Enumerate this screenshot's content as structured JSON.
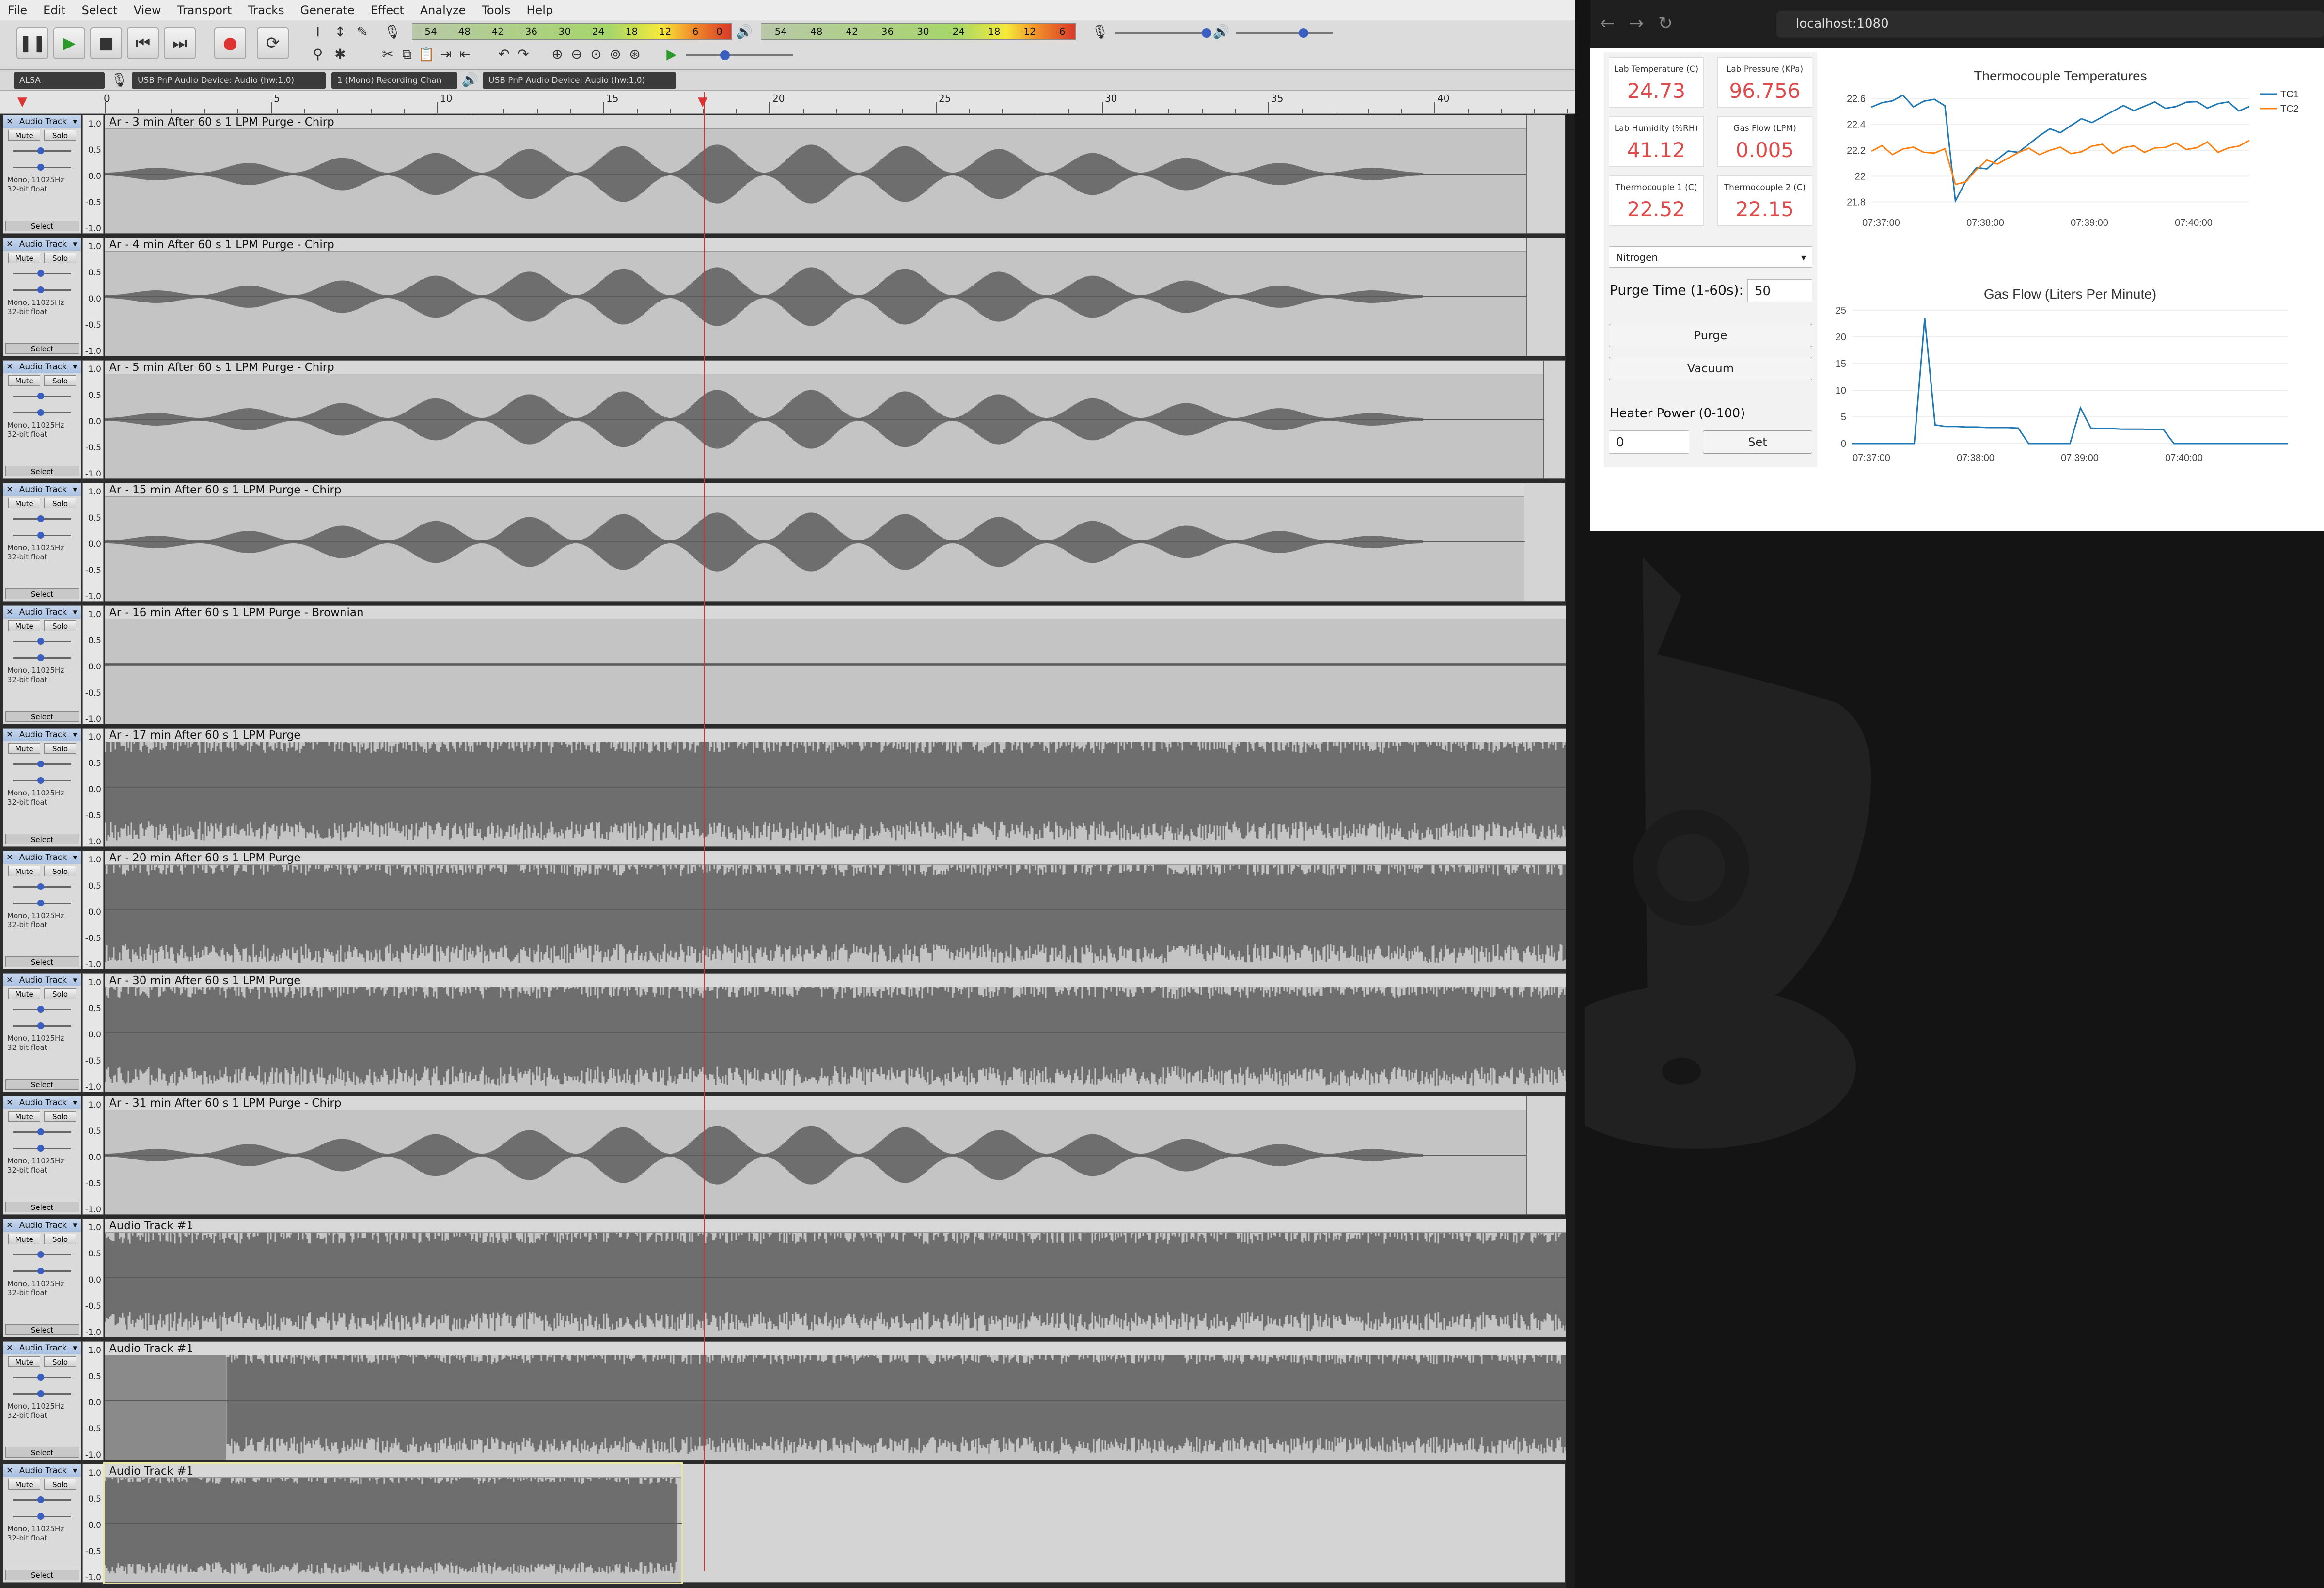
{
  "menu": [
    "File",
    "Edit",
    "Select",
    "View",
    "Transport",
    "Tracks",
    "Generate",
    "Effect",
    "Analyze",
    "Tools",
    "Help"
  ],
  "meter_rec": [
    "-54",
    "-48",
    "-42",
    "-36",
    "-30",
    "-24",
    "-18",
    "-12",
    "-6",
    "0"
  ],
  "meter_play": [
    "-54",
    "-48",
    "-42",
    "-36",
    "-30",
    "-24",
    "-18",
    "-12",
    "-6"
  ],
  "devices": {
    "host": "ALSA",
    "rec_device": "USB PnP Audio Device: Audio (hw:1,0)",
    "channels": "1 (Mono) Recording Chan",
    "play_device": "USB PnP Audio Device: Audio (hw:1,0)"
  },
  "ruler": [
    "5",
    "10",
    "15",
    "20",
    "25",
    "30",
    "35",
    "40"
  ],
  "ruler_zero": "0",
  "tcp": {
    "name": "Audio Track",
    "mute": "Mute",
    "solo": "Solo",
    "fmt1": "Mono, 11025Hz",
    "fmt2": "32-bit float",
    "select": "Select"
  },
  "vruler": [
    "1.0",
    "0.5",
    "0.0",
    "-0.5",
    "-1.0"
  ],
  "tracks": [
    {
      "title": "Ar - 3 min After 60 s 1 LPM Purge - Chirp",
      "kind": "chirp"
    },
    {
      "title": "Ar - 4 min After 60 s 1 LPM Purge - Chirp",
      "kind": "chirp"
    },
    {
      "title": "Ar - 5 min After 60 s 1 LPM Purge - Chirp",
      "kind": "chirp"
    },
    {
      "title": "Ar - 15 min After 60 s 1 LPM Purge - Chirp",
      "kind": "chirp"
    },
    {
      "title": "Ar - 16 min After 60 s 1 LPM Purge - Brownian",
      "kind": "flat"
    },
    {
      "title": "Ar - 17 min After 60 s 1 LPM Purge",
      "kind": "noise"
    },
    {
      "title": "Ar - 20 min After 60 s 1 LPM Purge",
      "kind": "noise"
    },
    {
      "title": "Ar - 30 min After 60 s 1 LPM Purge",
      "kind": "noise"
    },
    {
      "title": "Ar - 31 min After 60 s 1 LPM Purge - Chirp",
      "kind": "chirp"
    },
    {
      "title": "Audio Track #1",
      "kind": "noise"
    },
    {
      "title": "Audio Track #1",
      "kind": "noise_gap"
    },
    {
      "title": "Audio Track #1",
      "kind": "noise_short"
    }
  ],
  "browser": {
    "url": "localhost:1080"
  },
  "readouts": [
    {
      "label": "Lab Temperature (C)",
      "value": "24.73"
    },
    {
      "label": "Lab Pressure (KPa)",
      "value": "96.756"
    },
    {
      "label": "Lab Humidity (%RH)",
      "value": "41.12"
    },
    {
      "label": "Gas Flow (LPM)",
      "value": "0.005"
    },
    {
      "label": "Thermocouple 1 (C)",
      "value": "22.52"
    },
    {
      "label": "Thermocouple 2 (C)",
      "value": "22.15"
    }
  ],
  "controls": {
    "gas": "Nitrogen",
    "purge_label": "Purge Time (1-60s):",
    "purge_value": "50",
    "purge_btn": "Purge",
    "vacuum_btn": "Vacuum",
    "heater_label": "Heater Power (0-100)",
    "heater_value": "0",
    "set_btn": "Set"
  },
  "chart_data": [
    {
      "type": "line",
      "title": "Thermocouple Temperatures",
      "x_ticks": [
        "07:37:00",
        "07:38:00",
        "07:39:00",
        "07:40:00"
      ],
      "y_ticks": [
        "21.8",
        "22",
        "22.2",
        "22.4",
        "22.6"
      ],
      "ylim": [
        21.75,
        22.65
      ],
      "legend": "top-right",
      "series": [
        {
          "name": "TC1",
          "color": "#1f77b4",
          "values": [
            22.57,
            22.58,
            22.57,
            22.59,
            22.56,
            22.58,
            22.57,
            22.58,
            21.82,
            21.95,
            22.03,
            22.08,
            22.13,
            22.17,
            22.22,
            22.26,
            22.3,
            22.33,
            22.36,
            22.39,
            22.42,
            22.45,
            22.47,
            22.49,
            22.51,
            22.53,
            22.54,
            22.55,
            22.56,
            22.55,
            22.56,
            22.54,
            22.55,
            22.56,
            22.55,
            22.54,
            22.55
          ]
        },
        {
          "name": "TC2",
          "color": "#ff7f0e",
          "values": [
            22.18,
            22.2,
            22.19,
            22.21,
            22.2,
            22.22,
            22.19,
            22.2,
            21.9,
            21.98,
            22.05,
            22.1,
            22.13,
            22.15,
            22.17,
            22.18,
            22.19,
            22.2,
            22.2,
            22.21,
            22.2,
            22.22,
            22.21,
            22.2,
            22.22,
            22.21,
            22.22,
            22.23,
            22.21,
            22.22,
            22.23,
            22.22,
            22.24,
            22.22,
            22.23,
            22.22,
            22.24
          ]
        }
      ]
    },
    {
      "type": "line",
      "title": "Gas Flow (Liters Per Minute)",
      "x_ticks": [
        "07:37:00",
        "07:38:00",
        "07:39:00",
        "07:40:00"
      ],
      "y_ticks": [
        "0",
        "5",
        "10",
        "15",
        "20",
        "25"
      ],
      "ylim": [
        0,
        25
      ],
      "series": [
        {
          "name": "",
          "color": "#1f77b4",
          "values": [
            0,
            0,
            0,
            0,
            0,
            0,
            0,
            23.5,
            3.5,
            3.2,
            3.2,
            3.1,
            3.1,
            3.0,
            3.0,
            3.0,
            2.9,
            0,
            0,
            0,
            0,
            0,
            6.7,
            2.9,
            2.8,
            2.8,
            2.7,
            2.7,
            2.7,
            2.6,
            2.6,
            0,
            0,
            0,
            0,
            0,
            0,
            0,
            0,
            0,
            0,
            0,
            0
          ]
        }
      ]
    }
  ]
}
